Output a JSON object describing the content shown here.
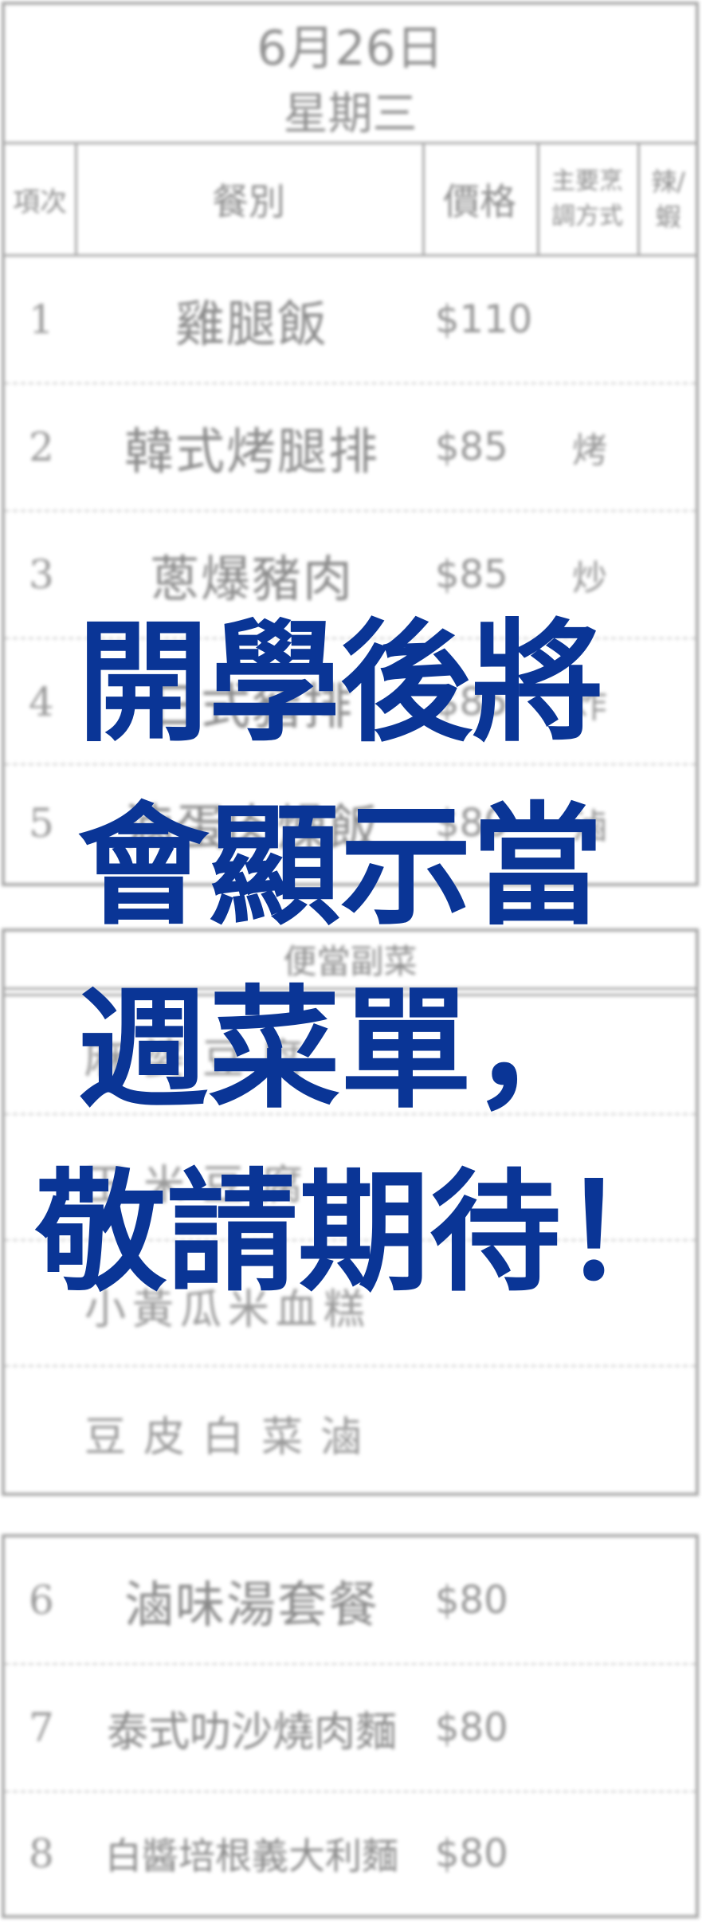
{
  "menu": {
    "date": "6月26日",
    "weekday": "星期三",
    "headers": {
      "item": "項次",
      "meal": "餐別",
      "price": "價格",
      "cooking_line1": "主要烹",
      "cooking_line2": "調方式",
      "spicy_line1": "辣/",
      "spicy_line2": "蝦"
    },
    "items": [
      {
        "no": "1",
        "name": "雞腿飯",
        "price": "$110",
        "cooking": ""
      },
      {
        "no": "2",
        "name": "韓式烤腿排",
        "price": "$85",
        "cooking": "烤"
      },
      {
        "no": "3",
        "name": "蔥爆豬肉",
        "price": "$85",
        "cooking": "炒"
      },
      {
        "no": "4",
        "name": "日式豬排",
        "price": "$85",
        "cooking": "炸"
      },
      {
        "no": "5",
        "name": "滷蛋肉燥飯",
        "price": "$80",
        "cooking": "滷"
      }
    ]
  },
  "sides": {
    "title": "便當副菜",
    "items": [
      "麻婆豆腐",
      "玉米豆腐",
      "小黃瓜米血糕",
      "豆皮白菜滷"
    ]
  },
  "noodles": {
    "items": [
      {
        "no": "6",
        "name": "滷味湯套餐",
        "price": "$80"
      },
      {
        "no": "7",
        "name": "泰式叻沙燒肉麵",
        "price": "$80"
      },
      {
        "no": "8",
        "name": "白醬培根義大利麵",
        "price": "$80"
      }
    ]
  },
  "overlay": {
    "line1": "開學後將",
    "line2": "會顯示當",
    "line3": "週菜單，",
    "line4": "敬請期待！",
    "color": "#0a3596"
  }
}
